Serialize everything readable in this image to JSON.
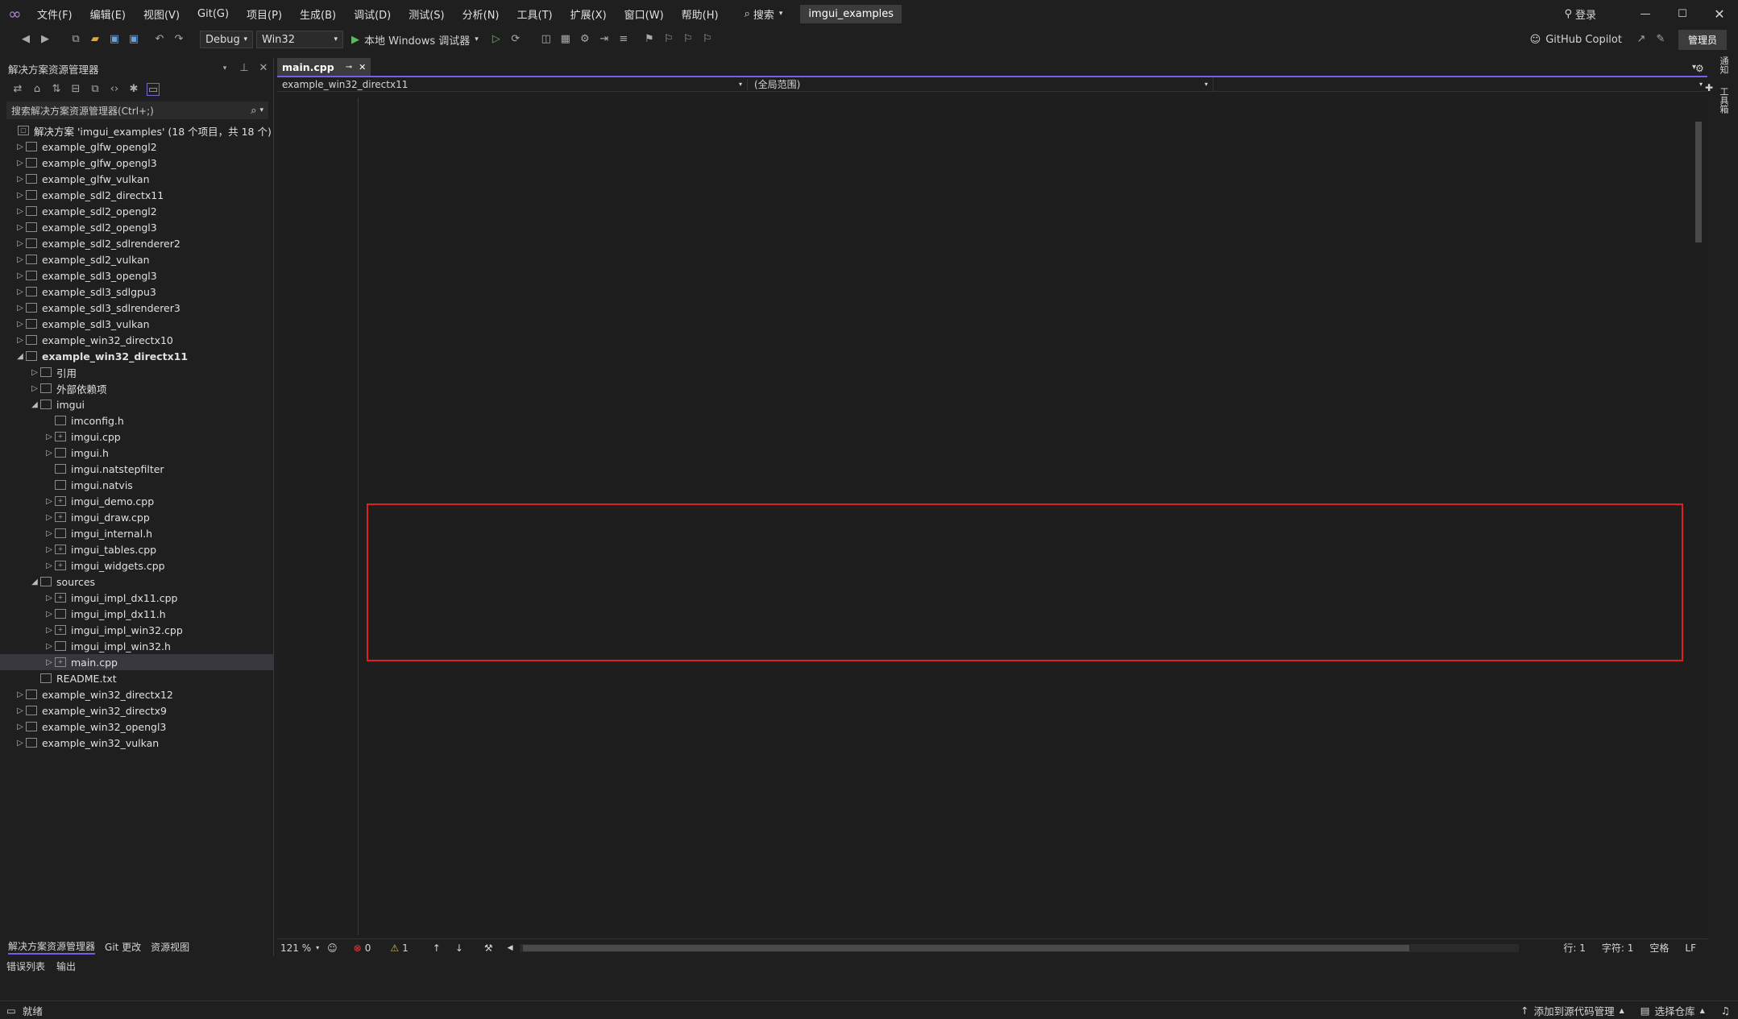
{
  "titlebar": {
    "menus": [
      "文件(F)",
      "编辑(E)",
      "视图(V)",
      "Git(G)",
      "项目(P)",
      "生成(B)",
      "调试(D)",
      "测试(S)",
      "分析(N)",
      "工具(T)",
      "扩展(X)",
      "窗口(W)",
      "帮助(H)"
    ],
    "search_label": "搜索",
    "project_name": "imgui_examples",
    "login": "登录"
  },
  "toolbar": {
    "config": "Debug",
    "platform": "Win32",
    "run_label": "本地 Windows 调试器",
    "copilot": "GitHub Copilot",
    "admin": "管理员"
  },
  "solution_explorer": {
    "title": "解决方案资源管理器",
    "search_placeholder": "搜索解决方案资源管理器(Ctrl+;)",
    "solution_label": "解决方案 'imgui_examples' (18 个项目，共 18 个)",
    "items": [
      {
        "label": "example_glfw_opengl2",
        "indent": 1,
        "arrow": "▷"
      },
      {
        "label": "example_glfw_opengl3",
        "indent": 1,
        "arrow": "▷"
      },
      {
        "label": "example_glfw_vulkan",
        "indent": 1,
        "arrow": "▷"
      },
      {
        "label": "example_sdl2_directx11",
        "indent": 1,
        "arrow": "▷"
      },
      {
        "label": "example_sdl2_opengl2",
        "indent": 1,
        "arrow": "▷"
      },
      {
        "label": "example_sdl2_opengl3",
        "indent": 1,
        "arrow": "▷"
      },
      {
        "label": "example_sdl2_sdlrenderer2",
        "indent": 1,
        "arrow": "▷"
      },
      {
        "label": "example_sdl2_vulkan",
        "indent": 1,
        "arrow": "▷"
      },
      {
        "label": "example_sdl3_opengl3",
        "indent": 1,
        "arrow": "▷"
      },
      {
        "label": "example_sdl3_sdlgpu3",
        "indent": 1,
        "arrow": "▷"
      },
      {
        "label": "example_sdl3_sdlrenderer3",
        "indent": 1,
        "arrow": "▷"
      },
      {
        "label": "example_sdl3_vulkan",
        "indent": 1,
        "arrow": "▷"
      },
      {
        "label": "example_win32_directx10",
        "indent": 1,
        "arrow": "▷"
      },
      {
        "label": "example_win32_directx11",
        "indent": 1,
        "arrow": "◢",
        "bold": true
      },
      {
        "label": "引用",
        "indent": 2,
        "arrow": "▷"
      },
      {
        "label": "外部依赖项",
        "indent": 2,
        "arrow": "▷"
      },
      {
        "label": "imgui",
        "indent": 2,
        "arrow": "◢"
      },
      {
        "label": "imconfig.h",
        "indent": 3,
        "arrow": ""
      },
      {
        "label": "imgui.cpp",
        "indent": 3,
        "arrow": "▷"
      },
      {
        "label": "imgui.h",
        "indent": 3,
        "arrow": "▷"
      },
      {
        "label": "imgui.natstepfilter",
        "indent": 3,
        "arrow": ""
      },
      {
        "label": "imgui.natvis",
        "indent": 3,
        "arrow": ""
      },
      {
        "label": "imgui_demo.cpp",
        "indent": 3,
        "arrow": "▷"
      },
      {
        "label": "imgui_draw.cpp",
        "indent": 3,
        "arrow": "▷"
      },
      {
        "label": "imgui_internal.h",
        "indent": 3,
        "arrow": "▷"
      },
      {
        "label": "imgui_tables.cpp",
        "indent": 3,
        "arrow": "▷"
      },
      {
        "label": "imgui_widgets.cpp",
        "indent": 3,
        "arrow": "▷"
      },
      {
        "label": "sources",
        "indent": 2,
        "arrow": "◢"
      },
      {
        "label": "imgui_impl_dx11.cpp",
        "indent": 3,
        "arrow": "▷"
      },
      {
        "label": "imgui_impl_dx11.h",
        "indent": 3,
        "arrow": "▷"
      },
      {
        "label": "imgui_impl_win32.cpp",
        "indent": 3,
        "arrow": "▷"
      },
      {
        "label": "imgui_impl_win32.h",
        "indent": 3,
        "arrow": "▷"
      },
      {
        "label": "main.cpp",
        "indent": 3,
        "arrow": "▷",
        "selected": true
      },
      {
        "label": "README.txt",
        "indent": 2,
        "arrow": ""
      },
      {
        "label": "example_win32_directx12",
        "indent": 1,
        "arrow": "▷"
      },
      {
        "label": "example_win32_directx9",
        "indent": 1,
        "arrow": "▷"
      },
      {
        "label": "example_win32_opengl3",
        "indent": 1,
        "arrow": "▷"
      },
      {
        "label": "example_win32_vulkan",
        "indent": 1,
        "arrow": "▷"
      }
    ],
    "bottom_tabs": [
      "解决方案资源管理器",
      "Git 更改",
      "资源视图"
    ]
  },
  "editor": {
    "tab": "main.cpp",
    "nav_left": "example_win32_directx11",
    "nav_right": "(全局范围)",
    "zoom": "121 %",
    "errors": "0",
    "warnings": "1",
    "line": "行: 1",
    "col": "字符: 1",
    "ws": "空格",
    "eol": "LF"
  },
  "bottom_panel": {
    "tabs": [
      "错误列表",
      "输出"
    ]
  },
  "status": {
    "ready": "就绪",
    "add_src": "添加到源代码管理",
    "select_repo": "选择仓库"
  },
  "right_strip": [
    "通知",
    "工具箱"
  ]
}
